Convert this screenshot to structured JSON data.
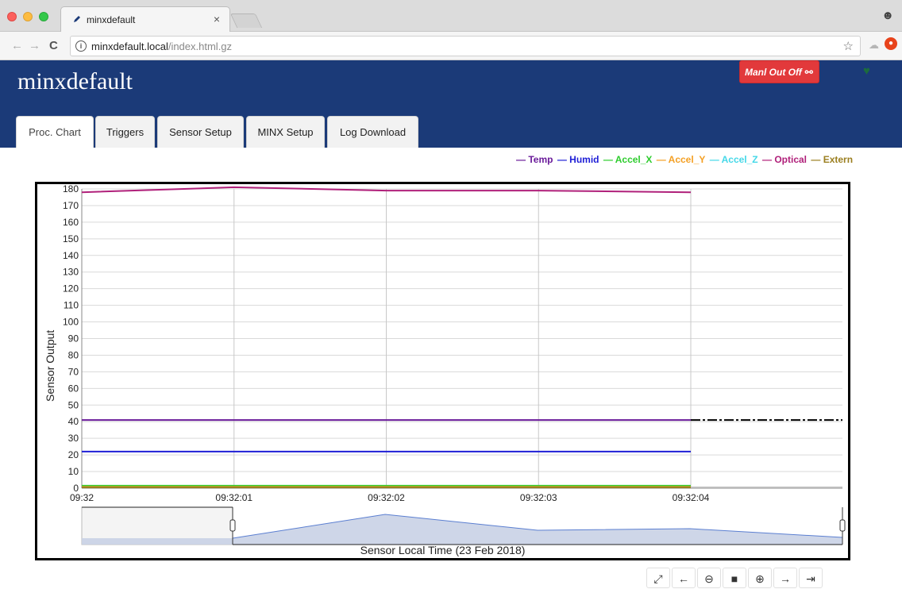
{
  "browser": {
    "tab_title": "minxdefault",
    "tab_close": "×",
    "url_host": "minxdefault.local",
    "url_path": "/index.html.gz"
  },
  "app": {
    "title": "minxdefault",
    "manual_button": "Manl Out Off",
    "tabs": [
      "Proc. Chart",
      "Triggers",
      "Sensor Setup",
      "MINX Setup",
      "Log Download"
    ],
    "active_tab": "Proc. Chart"
  },
  "legend": [
    {
      "name": "Temp",
      "color": "#6a1b9a"
    },
    {
      "name": "Humid",
      "color": "#1f1fd6"
    },
    {
      "name": "Accel_X",
      "color": "#2ecc2e"
    },
    {
      "name": "Accel_Y",
      "color": "#f4a024"
    },
    {
      "name": "Accel_Z",
      "color": "#44d8e8"
    },
    {
      "name": "Optical",
      "color": "#b0207a"
    },
    {
      "name": "Extern",
      "color": "#9b7f20"
    }
  ],
  "chart_data": {
    "type": "line",
    "ylabel": "Sensor Output",
    "xlabel": "Sensor Local Time (23 Feb 2018)",
    "ylim": [
      0,
      180
    ],
    "yticks": [
      0,
      10,
      20,
      30,
      40,
      50,
      60,
      70,
      80,
      90,
      100,
      110,
      120,
      130,
      140,
      150,
      160,
      170,
      180
    ],
    "xticks": [
      "09:32",
      "09:32:01",
      "09:32:02",
      "09:32:03",
      "09:32:04"
    ],
    "x": [
      0,
      1,
      2,
      3,
      4
    ],
    "series": [
      {
        "name": "Optical",
        "color": "#b0207a",
        "values": [
          178,
          181,
          179,
          179,
          178
        ]
      },
      {
        "name": "Temp",
        "color": "#6a1b9a",
        "values": [
          41,
          41,
          41,
          41,
          41
        ]
      },
      {
        "name": "Humid",
        "color": "#1f1fd6",
        "values": [
          22,
          22,
          22,
          22,
          22
        ]
      },
      {
        "name": "Accel_X",
        "color": "#2ecc2e",
        "values": [
          1.5,
          1.5,
          1.5,
          1.5,
          1.5
        ]
      },
      {
        "name": "Accel_Y",
        "color": "#f4a024",
        "values": [
          0.8,
          0.8,
          0.8,
          0.8,
          0.8
        ]
      },
      {
        "name": "Extern",
        "color": "#9b7f20",
        "values": [
          0.5,
          0.5,
          0.5,
          0.5,
          0.5
        ]
      }
    ],
    "grid": true
  },
  "toolbar": {
    "buttons": [
      "fit-icon",
      "pan-left-icon",
      "zoom-out-icon",
      "stop-icon",
      "zoom-in-icon",
      "pan-right-icon",
      "go-latest-icon"
    ]
  }
}
